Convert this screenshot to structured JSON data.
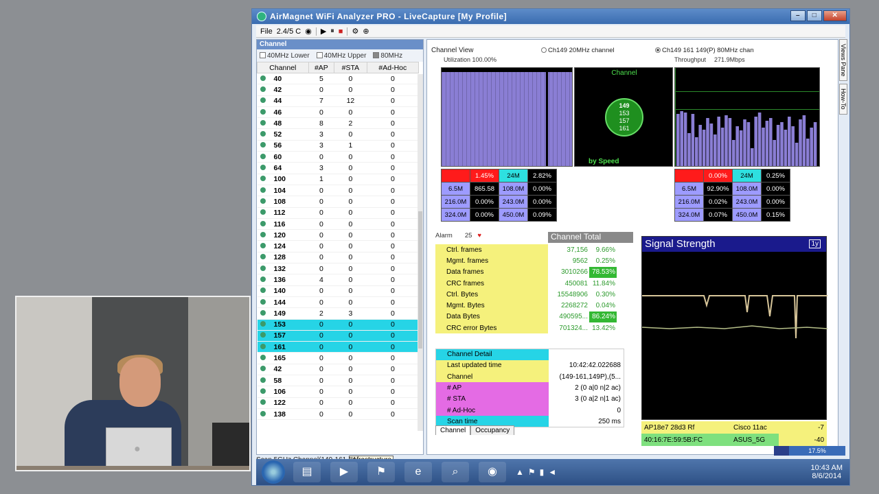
{
  "window": {
    "title": "AirMagnet WiFi Analyzer PRO - LiveCapture [My Profile]"
  },
  "toolbar": {
    "file": "File",
    "band": "2.4/5 C"
  },
  "left_pane": {
    "title": "Channel",
    "bw_options": [
      "40MHz Lower",
      "40MHz Upper",
      "80MHz"
    ],
    "columns": [
      "Channel",
      "#AP",
      "#STA",
      "#Ad-Hoc"
    ],
    "rows": [
      [
        "40",
        "5",
        "0",
        "0"
      ],
      [
        "42",
        "0",
        "0",
        "0"
      ],
      [
        "44",
        "7",
        "12",
        "0"
      ],
      [
        "46",
        "0",
        "0",
        "0"
      ],
      [
        "48",
        "8",
        "2",
        "0"
      ],
      [
        "52",
        "3",
        "0",
        "0"
      ],
      [
        "56",
        "3",
        "1",
        "0"
      ],
      [
        "60",
        "0",
        "0",
        "0"
      ],
      [
        "64",
        "3",
        "0",
        "0"
      ],
      [
        "100",
        "1",
        "0",
        "0"
      ],
      [
        "104",
        "0",
        "0",
        "0"
      ],
      [
        "108",
        "0",
        "0",
        "0"
      ],
      [
        "112",
        "0",
        "0",
        "0"
      ],
      [
        "116",
        "0",
        "0",
        "0"
      ],
      [
        "120",
        "0",
        "0",
        "0"
      ],
      [
        "124",
        "0",
        "0",
        "0"
      ],
      [
        "128",
        "0",
        "0",
        "0"
      ],
      [
        "132",
        "0",
        "0",
        "0"
      ],
      [
        "136",
        "4",
        "0",
        "0"
      ],
      [
        "140",
        "0",
        "0",
        "0"
      ],
      [
        "144",
        "0",
        "0",
        "0"
      ],
      [
        "149",
        "2",
        "3",
        "0"
      ],
      [
        "153",
        "0",
        "0",
        "0"
      ],
      [
        "157",
        "0",
        "0",
        "0"
      ],
      [
        "161",
        "0",
        "0",
        "0"
      ],
      [
        "165",
        "0",
        "0",
        "0"
      ],
      [
        "42",
        "0",
        "0",
        "0"
      ],
      [
        "58",
        "0",
        "0",
        "0"
      ],
      [
        "106",
        "0",
        "0",
        "0"
      ],
      [
        "122",
        "0",
        "0",
        "0"
      ],
      [
        "138",
        "0",
        "0",
        "0"
      ]
    ],
    "selected_rows": [
      22,
      23,
      24
    ],
    "tooltip": "Infrastructure"
  },
  "channel_view": {
    "title": "Channel View",
    "utilization": "Utilization 100.00%",
    "opt20": "Ch149 20MHz channel",
    "opt80": "Ch149 161 149(P) 80MHz chan",
    "throughput_label": "Throughput",
    "throughput_value": "271.9Mbps",
    "center_label": "Channel",
    "center_channels": [
      "149",
      "153",
      "157",
      "161"
    ],
    "by_speed": "by Speed"
  },
  "stats_left": [
    [
      "",
      "1.45%",
      "24M",
      "2.82%"
    ],
    [
      "6.5M",
      "865.58",
      "108.0M",
      "0.00%"
    ],
    [
      "216.0M",
      "0.00%",
      "243.0M",
      "0.00%"
    ],
    [
      "324.0M",
      "0.00%",
      "450.0M",
      "0.09%"
    ]
  ],
  "stats_right": [
    [
      "",
      "0.00%",
      "24M",
      "0.25%"
    ],
    [
      "6.5M",
      "92.90%",
      "108.0M",
      "0.00%"
    ],
    [
      "216.0M",
      "0.02%",
      "243.0M",
      "0.00%"
    ],
    [
      "324.0M",
      "0.07%",
      "450.0M",
      "0.15%"
    ]
  ],
  "alarm": {
    "label": "Alarm",
    "count": "25"
  },
  "totals": {
    "header": "Channel Total",
    "rows": [
      [
        "Ctrl. frames",
        "37,156",
        "9.66%"
      ],
      [
        "Mgmt. frames",
        "9562",
        "0.25%"
      ],
      [
        "Data frames",
        "3010266",
        "78.53%"
      ],
      [
        "CRC frames",
        "450081",
        "11.84%"
      ],
      [
        "Ctrl. Bytes",
        "15548906",
        "0.30%"
      ],
      [
        "Mgmt. Bytes",
        "2268272",
        "0.04%"
      ],
      [
        "Data Bytes",
        "490595...",
        "86.24%"
      ],
      [
        "CRC error Bytes",
        "701324...",
        "13.42%"
      ]
    ]
  },
  "detail": {
    "rows": [
      [
        "Channel Detail",
        ""
      ],
      [
        "Last updated time",
        "10:42:42.022688"
      ],
      [
        "Channel",
        "(149-161,149P),(5..."
      ],
      [
        "# AP",
        "2 (0 a|0 n|2 ac)"
      ],
      [
        "# STA",
        "3 (0 a|2 n|1 ac)"
      ],
      [
        "# Ad-Hoc",
        "0"
      ],
      [
        "Scan time",
        "250 ms"
      ]
    ]
  },
  "tabs": [
    "Channel",
    "Occupancy"
  ],
  "signal": {
    "title": "Signal Strength",
    "aps": [
      [
        "AP18e7 28d3 Rf",
        "Cisco 11ac",
        "-7"
      ],
      [
        "40:16:7E:59:5B:FC",
        "ASUS_5G",
        "-40"
      ]
    ]
  },
  "side_tabs": [
    "Views Pane",
    "How-To"
  ],
  "status": {
    "text": "Scan 5GHz Channel(149-161,14",
    "progress": "17.5%"
  },
  "taskbar": {
    "time": "10:43 AM",
    "date": "8/6/2014"
  }
}
